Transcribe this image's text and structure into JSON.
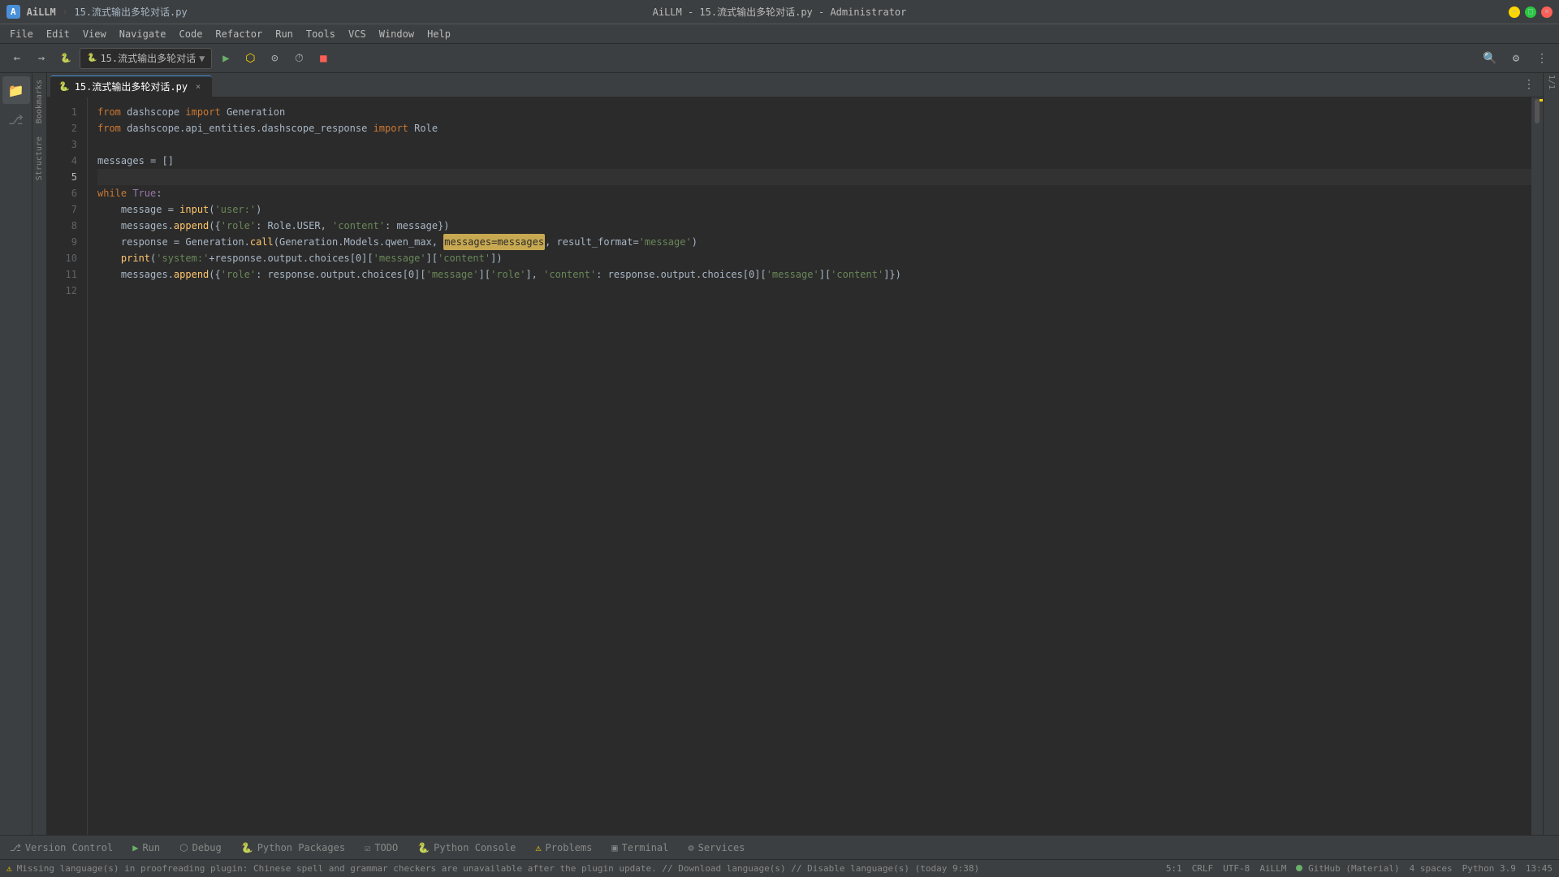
{
  "titlebar": {
    "app_logo": "A",
    "app_name": "AiLLM",
    "breadcrumb": "15.流式输出多轮对话.py",
    "title": "AiLLM - 15.流式输出多轮对话.py - Administrator",
    "minimize": "−",
    "maximize": "□",
    "close": "×"
  },
  "menubar": {
    "items": [
      "File",
      "Edit",
      "View",
      "Navigate",
      "Code",
      "Refactor",
      "Run",
      "Tools",
      "VCS",
      "Window",
      "Help"
    ]
  },
  "toolbar": {
    "run_config": "15.流式输出多轮对话",
    "run_label": "▶",
    "debug_label": "🐛",
    "more_icon": "⋮"
  },
  "tabs": [
    {
      "label": "15.流式输出多轮对话.py",
      "active": true
    }
  ],
  "code": {
    "lines": [
      {
        "num": 1,
        "text": "from dashscope import Generation",
        "tokens": [
          {
            "type": "kw",
            "text": "from "
          },
          {
            "type": "mod",
            "text": "dashscope "
          },
          {
            "type": "kw",
            "text": "import "
          },
          {
            "type": "cls",
            "text": "Generation"
          }
        ]
      },
      {
        "num": 2,
        "text": "from dashscope.api_entities.dashscope_response import Role",
        "tokens": [
          {
            "type": "kw",
            "text": "from "
          },
          {
            "type": "mod",
            "text": "dashscope.api_entities.dashscope_response "
          },
          {
            "type": "kw",
            "text": "import "
          },
          {
            "type": "cls",
            "text": "Role"
          }
        ]
      },
      {
        "num": 3,
        "text": ""
      },
      {
        "num": 4,
        "text": "messages = []",
        "tokens": [
          {
            "type": "cls",
            "text": "messages "
          },
          {
            "type": "cls",
            "text": "= "
          },
          {
            "type": "cls",
            "text": "[]"
          }
        ]
      },
      {
        "num": 5,
        "text": "",
        "active": true
      },
      {
        "num": 6,
        "text": "while True:",
        "tokens": [
          {
            "type": "kw",
            "text": "while "
          },
          {
            "type": "kw2",
            "text": "True"
          },
          {
            "type": "cls",
            "text": ":"
          }
        ]
      },
      {
        "num": 7,
        "text": "    message = input('user:')",
        "tokens": [
          {
            "type": "cls",
            "text": "    message = "
          },
          {
            "type": "fn",
            "text": "input"
          },
          {
            "type": "cls",
            "text": "("
          },
          {
            "type": "str",
            "text": "'user:'"
          },
          {
            "type": "cls",
            "text": ")"
          }
        ]
      },
      {
        "num": 8,
        "text": "    messages.append({'role': Role.USER, 'content': message})",
        "tokens": [
          {
            "type": "cls",
            "text": "    messages."
          },
          {
            "type": "fn",
            "text": "append"
          },
          {
            "type": "cls",
            "text": "({"
          },
          {
            "type": "str",
            "text": "'role'"
          },
          {
            "type": "cls",
            "text": ": Role.USER, "
          },
          {
            "type": "str",
            "text": "'content'"
          },
          {
            "type": "cls",
            "text": ": message})"
          }
        ]
      },
      {
        "num": 9,
        "text": "    response = Generation.call(Generation.Models.qwen_max, messages=messages, result_format='message')",
        "tokens": [
          {
            "type": "cls",
            "text": "    response = Generation."
          },
          {
            "type": "fn",
            "text": "call"
          },
          {
            "type": "cls",
            "text": "(Generation.Models.qwen_max, "
          },
          {
            "type": "hi",
            "text": "messages=messages"
          },
          {
            "type": "cls",
            "text": ", result_format="
          },
          {
            "type": "str",
            "text": "'message'"
          },
          {
            "type": "cls",
            "text": ")"
          }
        ]
      },
      {
        "num": 10,
        "text": "    print('system:'+response.output.choices[0]['message']['content'])",
        "tokens": [
          {
            "type": "cls",
            "text": "    "
          },
          {
            "type": "fn",
            "text": "print"
          },
          {
            "type": "cls",
            "text": "("
          },
          {
            "type": "str",
            "text": "'system:'"
          },
          {
            "type": "cls",
            "text": "+response.output.choices[0]["
          },
          {
            "type": "str",
            "text": "'message'"
          },
          {
            "type": "cls",
            "text": "]["
          },
          {
            "type": "str",
            "text": "'content'"
          },
          {
            "type": "cls",
            "text": "])"
          }
        ]
      },
      {
        "num": 11,
        "text": "    messages.append({'role': response.output.choices[0]['message']['role'], 'content': response.output.choices[0]['message']['content']})",
        "tokens": [
          {
            "type": "cls",
            "text": "    messages."
          },
          {
            "type": "fn",
            "text": "append"
          },
          {
            "type": "cls",
            "text": "({"
          },
          {
            "type": "str",
            "text": "'role'"
          },
          {
            "type": "cls",
            "text": ": response.output.choices[0]["
          },
          {
            "type": "str",
            "text": "'message'"
          },
          {
            "type": "cls",
            "text": "]["
          },
          {
            "type": "str",
            "text": "'role'"
          },
          {
            "type": "cls",
            "text": "], "
          },
          {
            "type": "str",
            "text": "'content'"
          },
          {
            "type": "cls",
            "text": ": response.output.choices[0]["
          },
          {
            "type": "str",
            "text": "'message'"
          },
          {
            "type": "cls",
            "text": "]["
          },
          {
            "type": "str",
            "text": "'content'"
          },
          {
            "type": "cls",
            "text": "]})"
          }
        ]
      },
      {
        "num": 12,
        "text": ""
      }
    ]
  },
  "bottom_tabs": [
    {
      "label": "Version Control",
      "icon": "⎇"
    },
    {
      "label": "Run",
      "icon": "▶"
    },
    {
      "label": "Debug",
      "icon": "🐛"
    },
    {
      "label": "Python Packages",
      "icon": "📦"
    },
    {
      "label": "TODO",
      "icon": "☑"
    },
    {
      "label": "Python Console",
      "icon": "🐍"
    },
    {
      "label": "Problems",
      "icon": "⚠"
    },
    {
      "label": "Terminal",
      "icon": "▣"
    },
    {
      "label": "Services",
      "icon": "⚙"
    }
  ],
  "statusbar": {
    "warning_icon": "⚠",
    "status_msg": "Missing language(s) in proofreading plugin: Chinese spell and grammar checkers are unavailable after the plugin update. // Download language(s) // Disable language(s) (today 9:38)",
    "position": "5:1",
    "line_ending": "CRLF",
    "encoding": "UTF-8",
    "theme": "AiLLM",
    "vcs": "GitHub (Material)",
    "green_dot": true,
    "indent": "4 spaces",
    "lang": "Python 3.9",
    "time": "13:45"
  },
  "side_labels": {
    "bookmarks": "Bookmarks",
    "structure": "Structure"
  },
  "scroll_indicator": "1/1"
}
